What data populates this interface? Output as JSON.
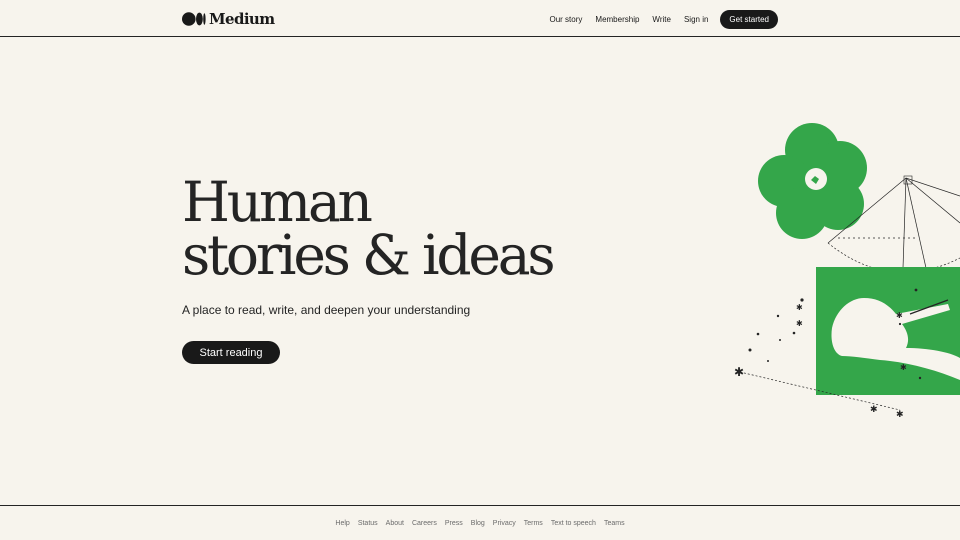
{
  "header": {
    "logo_text": "Medium",
    "nav": [
      {
        "label": "Our story"
      },
      {
        "label": "Membership"
      },
      {
        "label": "Write"
      },
      {
        "label": "Sign in"
      }
    ],
    "get_started_label": "Get started"
  },
  "hero": {
    "title_line1": "Human",
    "title_line2": "stories & ideas",
    "subtitle": "A place to read, write, and deepen your understanding",
    "cta_label": "Start reading"
  },
  "footer": {
    "links": [
      {
        "label": "Help"
      },
      {
        "label": "Status"
      },
      {
        "label": "About"
      },
      {
        "label": "Careers"
      },
      {
        "label": "Press"
      },
      {
        "label": "Blog"
      },
      {
        "label": "Privacy"
      },
      {
        "label": "Terms"
      },
      {
        "label": "Text to speech"
      },
      {
        "label": "Teams"
      }
    ]
  },
  "colors": {
    "background": "#f7f4ed",
    "text": "#242424",
    "button": "#191919",
    "illustration_green": "#34a64a"
  },
  "icons": {
    "logo": "medium-logo-icon",
    "illustration": "flower-hand-illustration"
  }
}
